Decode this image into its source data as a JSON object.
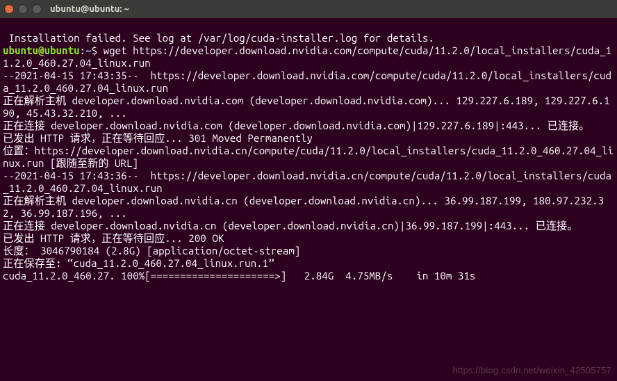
{
  "window": {
    "title": "ubuntu@ubuntu: ~"
  },
  "prompt": {
    "user": "ubuntu",
    "at": "@",
    "host": "ubuntu",
    "colon": ":",
    "path": "~",
    "symbol": "$ "
  },
  "lines": {
    "l0": " Installation failed. See log at /var/log/cuda-installer.log for details.",
    "cmd": "wget https://developer.download.nvidia.com/compute/cuda/11.2.0/local_installers/cuda_11.2.0_460.27.04_linux.run",
    "l2": "--2021-04-15 17:43:35--  https://developer.download.nvidia.com/compute/cuda/11.2.0/local_installers/cuda_11.2.0_460.27.04_linux.run",
    "l3": "正在解析主机 developer.download.nvidia.com (developer.download.nvidia.com)... 129.227.6.189, 129.227.6.190, 45.43.32.210, ...",
    "l4": "正在连接 developer.download.nvidia.com (developer.download.nvidia.com)|129.227.6.189|:443... 已连接。",
    "l5": "已发出 HTTP 请求，正在等待回应... 301 Moved Permanently",
    "l6": "位置：https://developer.download.nvidia.cn/compute/cuda/11.2.0/local_installers/cuda_11.2.0_460.27.04_linux.run [跟随至新的 URL]",
    "l7": "--2021-04-15 17:43:36--  https://developer.download.nvidia.cn/compute/cuda/11.2.0/local_installers/cuda_11.2.0_460.27.04_linux.run",
    "l8": "正在解析主机 developer.download.nvidia.cn (developer.download.nvidia.cn)... 36.99.187.199, 180.97.232.32, 36.99.187.196, ...",
    "l9": "正在连接 developer.download.nvidia.cn (developer.download.nvidia.cn)|36.99.187.199|:443... 已连接。",
    "l10": "已发出 HTTP 请求，正在等待回应... 200 OK",
    "l11": "长度： 3046790184 (2.8G) [application/octet-stream]",
    "l12": "正在保存至: “cuda_11.2.0_460.27.04_linux.run.1”",
    "blank": "",
    "progress": "cuda_11.2.0_460.27. 100%[=====================>]   2.84G  4.75MB/s    in 10m 31s"
  },
  "watermark": "https://blog.csdn.net/weixin_42505757"
}
